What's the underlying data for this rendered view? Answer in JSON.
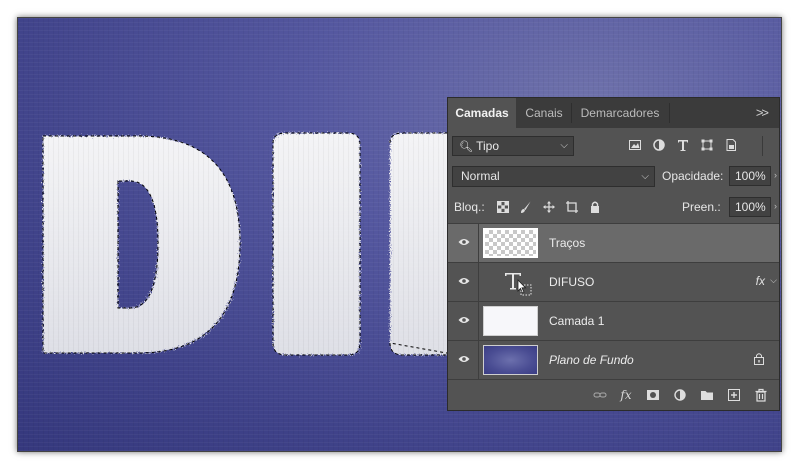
{
  "tabs": [
    {
      "label": "Camadas",
      "active": true
    },
    {
      "label": "Canais",
      "active": false
    },
    {
      "label": "Demarcadores",
      "active": false
    }
  ],
  "panel_menu_icon": ">>",
  "filter": {
    "value": "Tipo",
    "icon": "search-icon"
  },
  "blend_mode": "Normal",
  "opacity": {
    "label": "Opacidade:",
    "value": "100%"
  },
  "lock": {
    "label": "Bloq.:"
  },
  "fill": {
    "label": "Preen.:",
    "value": "100%"
  },
  "layers": [
    {
      "name": "Traços",
      "type": "pixel-transparent",
      "selected": true
    },
    {
      "name": "DIFUSO",
      "type": "text",
      "effects_label": "fx"
    },
    {
      "name": "Camada 1",
      "type": "pixel-white"
    },
    {
      "name": "Plano de Fundo",
      "type": "background",
      "locked": true
    }
  ],
  "canvas": {
    "visible_letters": "DI",
    "background_color": "#4c4f97"
  },
  "bottom_icons": [
    "link-icon",
    "fx-icon",
    "mask-icon",
    "adjustment-icon",
    "folder-icon",
    "new-layer-icon",
    "trash-icon"
  ]
}
